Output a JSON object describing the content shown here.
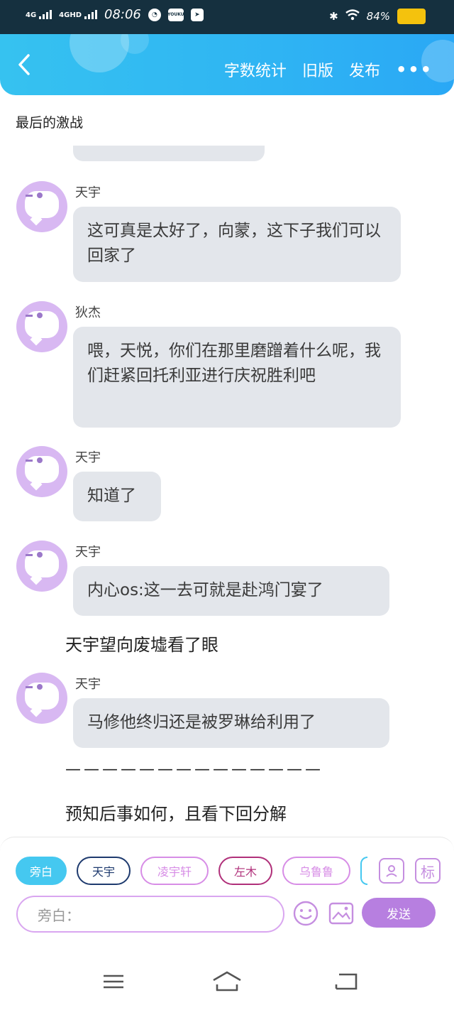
{
  "status": {
    "network1": "4G",
    "network2": "4GHD",
    "time": "08:06",
    "app_icon": "YOUKU",
    "battery_text": "84%"
  },
  "header": {
    "word_count": "字数统计",
    "old_version": "旧版",
    "publish": "发布",
    "more": "•••"
  },
  "doc_title": "最后的激战",
  "messages": [
    {
      "speaker": "天宇",
      "text": "这可真是太好了，向蒙，这下子我们可以回家了"
    },
    {
      "speaker": "狄杰",
      "text": "喂，天悦，你们在那里磨蹭着什么呢，我们赶紧回托利亚进行庆祝胜利吧"
    },
    {
      "speaker": "天宇",
      "text": "知道了"
    },
    {
      "speaker": "天宇",
      "text": "内心os:这一去可就是赴鸿门宴了"
    },
    {
      "speaker": "天宇",
      "text": "马修他终归还是被罗琳给利用了"
    }
  ],
  "narration": {
    "look": "天宇望向废墟看了眼",
    "dashes": "——————————————",
    "ending": "预知后事如何，且看下回分解"
  },
  "roles": [
    "旁白",
    "天宇",
    "凌宇轩",
    "左木",
    "乌鲁鲁"
  ],
  "role_colors": {
    "active_bg": "#45c8f0",
    "tianyu": "#1e3a6e",
    "pink": "#d78de6",
    "zuomu": "#b0307a"
  },
  "tools": {
    "mark": "标"
  },
  "input": {
    "placeholder": "旁白："
  },
  "send_label": "发送",
  "accent": "#b77fe0"
}
